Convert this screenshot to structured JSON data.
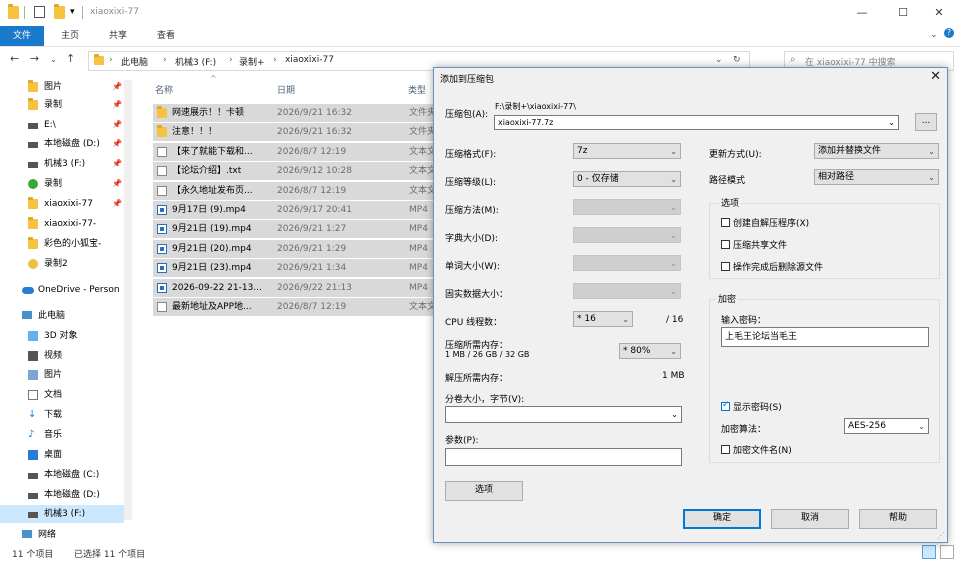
{
  "window": {
    "title": "xiaoxixi-77",
    "controls": [
      "minimize-icon",
      "maximize-icon",
      "close-icon"
    ]
  },
  "ribbon": {
    "tabs": [
      "文件",
      "主页",
      "共享",
      "查看"
    ]
  },
  "address": {
    "crumbs": [
      "此电脑",
      "机械3 (F:)",
      "录制+",
      "xiaoxixi-77"
    ],
    "search_placeholder": "在 xiaoxixi-77 中搜索"
  },
  "sidebar": {
    "quick": [
      {
        "label": "图片",
        "pinned": true
      },
      {
        "label": "录制",
        "pinned": true
      },
      {
        "label": "E:\\",
        "pinned": true
      },
      {
        "label": "本地磁盘 (D:)",
        "pinned": true
      },
      {
        "label": "机械3 (F:)",
        "pinned": true
      },
      {
        "label": "录制",
        "pinned": true
      },
      {
        "label": "xiaoxixi-77",
        "pinned": true
      },
      {
        "label": "xiaoxixi-77-",
        "pinned": false
      },
      {
        "label": "彩色的小狐宝-",
        "pinned": false
      },
      {
        "label": "录制2",
        "pinned": false
      }
    ],
    "onedrive": "OneDrive - Person",
    "thispc": "此电脑",
    "pc_items": [
      "3D 对象",
      "视频",
      "图片",
      "文档",
      "下载",
      "音乐",
      "桌面",
      "本地磁盘 (C:)",
      "本地磁盘 (D:)",
      "机械3 (F:)"
    ],
    "network": "网络"
  },
  "filelist": {
    "columns": [
      "名称",
      "日期",
      "类型"
    ],
    "rows": [
      {
        "name": "网速展示！！卡顿",
        "date": "2026/9/21 16:32",
        "type": "文件夹",
        "kind": "folder"
      },
      {
        "name": "注意！！！",
        "date": "2026/9/21 16:32",
        "type": "文件夹",
        "kind": "folder"
      },
      {
        "name": "【来了就能下载和...",
        "date": "2026/8/7 12:19",
        "type": "文本文",
        "kind": "txt"
      },
      {
        "name": "【论坛介绍】.txt",
        "date": "2026/9/12 10:28",
        "type": "文本文",
        "kind": "txt"
      },
      {
        "name": "【永久地址发布页...",
        "date": "2026/8/7 12:19",
        "type": "文本文",
        "kind": "txt"
      },
      {
        "name": "9月17日 (9).mp4",
        "date": "2026/9/17 20:41",
        "type": "MP4",
        "kind": "mp4"
      },
      {
        "name": "9月21日 (19).mp4",
        "date": "2026/9/21 1:27",
        "type": "MP4",
        "kind": "mp4"
      },
      {
        "name": "9月21日 (20).mp4",
        "date": "2026/9/21 1:29",
        "type": "MP4",
        "kind": "mp4"
      },
      {
        "name": "9月21日 (23).mp4",
        "date": "2026/9/21 1:34",
        "type": "MP4",
        "kind": "mp4"
      },
      {
        "name": "2026-09-22 21-13...",
        "date": "2026/9/22 21:13",
        "type": "MP4",
        "kind": "mp4"
      },
      {
        "name": "最新地址及APP地...",
        "date": "2026/8/7 12:19",
        "type": "文本文",
        "kind": "txt"
      }
    ]
  },
  "status": {
    "count": "11 个项目",
    "selected": "已选择 11 个项目"
  },
  "dialog": {
    "title": "添加到压缩包",
    "archive_label": "压缩包(A):",
    "archive_path": "F:\\录制+\\xiaoxixi-77\\",
    "archive_name": "xiaoxixi-77.7z",
    "browse_label": "...",
    "format_label": "压缩格式(F):",
    "format_value": "7z",
    "level_label": "压缩等级(L):",
    "level_value": "0 - 仅存储",
    "method_label": "压缩方法(M):",
    "dict_label": "字典大小(D):",
    "word_label": "单词大小(W):",
    "solid_label": "固实数据大小：",
    "cpu_label": "CPU 线程数：",
    "cpu_value": "* 16",
    "cpu_max": "/ 16",
    "mem_label": "压缩所需内存：",
    "mem_detail": "1 MB / 26 GB / 32 GB",
    "mem_value": "* 80%",
    "decomp_label": "解压所需内存：",
    "decomp_value": "1 MB",
    "volume_label": "分卷大小，字节(V):",
    "params_label": "参数(P):",
    "options_button": "选项",
    "update_label": "更新方式(U):",
    "update_value": "添加并替换文件",
    "path_label": "路径模式",
    "path_value": "相对路径",
    "options_group": "选项",
    "opt_sfx": "创建自解压程序(X)",
    "opt_shared": "压缩共享文件",
    "opt_delete": "操作完成后删除源文件",
    "encrypt_group": "加密",
    "password_label": "输入密码：",
    "password_value": "上毛王论坛当毛王",
    "show_password": "显示密码(S)",
    "enc_method_label": "加密算法：",
    "enc_method_value": "AES-256",
    "encrypt_names": "加密文件名(N)",
    "ok": "确定",
    "cancel": "取消",
    "help": "帮助"
  }
}
